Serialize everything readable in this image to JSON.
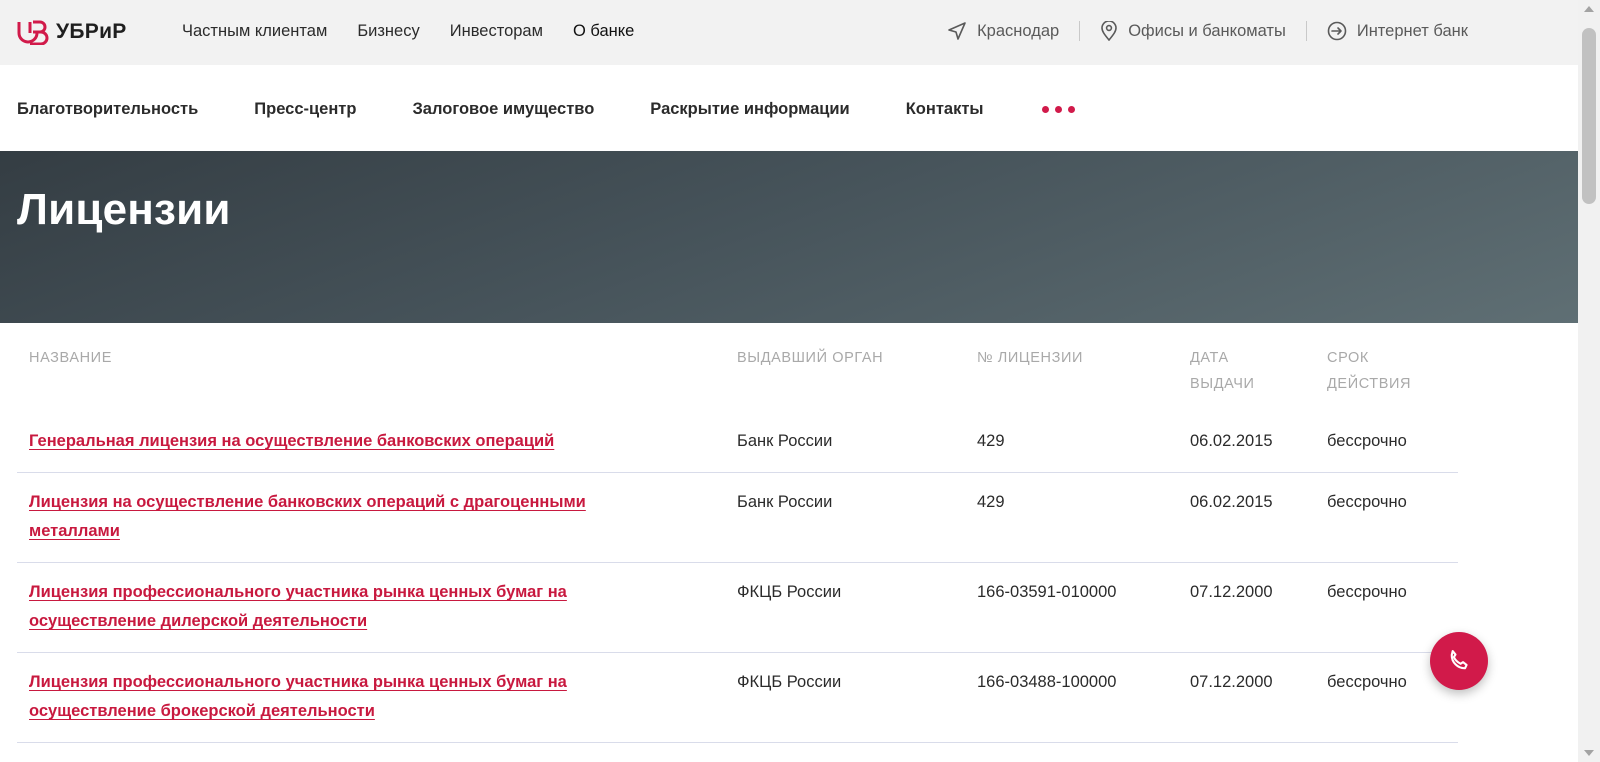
{
  "brand": {
    "name": "УБРиР",
    "accent": "#d11a4a"
  },
  "top_nav": {
    "items": [
      "Частным клиентам",
      "Бизнесу",
      "Инвесторам",
      "О банке"
    ],
    "city": "Краснодар",
    "offices": "Офисы и банкоматы",
    "internet_bank": "Интернет банк"
  },
  "sub_nav": {
    "items": [
      "Благотворительность",
      "Пресс-центр",
      "Залоговое имущество",
      "Раскрытие информации",
      "Контакты"
    ],
    "more_icon": "more-dots-icon"
  },
  "page": {
    "title": "Лицензии"
  },
  "table": {
    "headers": {
      "name": "НАЗВАНИЕ",
      "issuer": "ВЫДАВШИЙ ОРГАН",
      "number": "№ ЛИЦЕНЗИИ",
      "date_line1": "ДАТА",
      "date_line2": "ВЫДАЧИ",
      "term_line1": "СРОК",
      "term_line2": "ДЕЙСТВИЯ"
    },
    "rows": [
      {
        "name": "Генеральная лицензия на осуществление банковских операций",
        "issuer": "Банк России",
        "number": "429",
        "date": "06.02.2015",
        "term": "бессрочно"
      },
      {
        "name": "Лицензия на осуществление банковских операций с драгоценными металлами",
        "issuer": "Банк России",
        "number": "429",
        "date": "06.02.2015",
        "term": "бессрочно"
      },
      {
        "name": "Лицензия профессионального участника рынка ценных бумаг на осуществление дилерской деятельности",
        "issuer": "ФКЦБ России",
        "number": "166-03591-010000",
        "date": "07.12.2000",
        "term": "бессрочно"
      },
      {
        "name": "Лицензия профессионального участника рынка ценных бумаг на осуществление брокерской деятельности",
        "issuer": "ФКЦБ России",
        "number": "166-03488-100000",
        "date": "07.12.2000",
        "term": "бессрочно"
      }
    ]
  },
  "call_button": {
    "icon": "phone-icon"
  }
}
